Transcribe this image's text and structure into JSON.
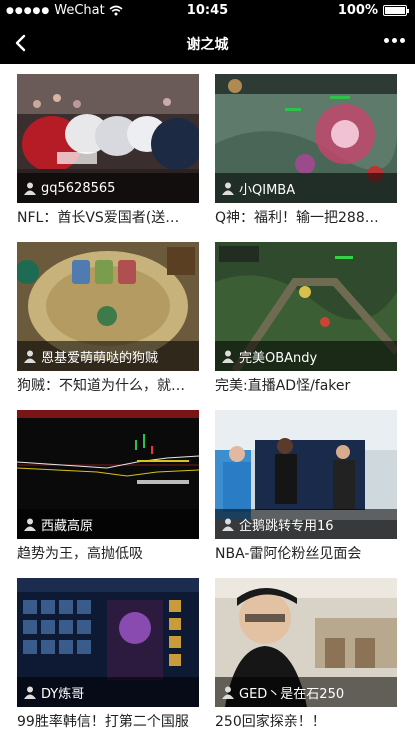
{
  "status_bar": {
    "signal_dots": "●●●●●",
    "carrier": "WeChat",
    "time": "10:45",
    "battery": "100%",
    "wifi_icon": "wifi-icon",
    "battery_level": 1.0
  },
  "nav": {
    "title": "谢之城",
    "back_icon": "chevron-left-icon",
    "more_icon": "more-dots-icon"
  },
  "cards": [
    {
      "user": "gq5628565",
      "caption": "NFL：酋长VS爱国者(送…"
    },
    {
      "user": "小QIMBA",
      "caption": "Q神：福利！输一把288…"
    },
    {
      "user": "恩基爱萌萌哒的狗贼",
      "caption": "狗贼：不知道为什么，就…"
    },
    {
      "user": "完美OBAndy",
      "caption": "完美:直播AD怪/faker"
    },
    {
      "user": "西藏高原",
      "caption": "趋势为王，高抛低吸"
    },
    {
      "user": "企鹅跳转专用16",
      "caption": "NBA-雷阿伦粉丝见面会"
    },
    {
      "user": "DY炼哥",
      "caption": "99胜率韩信！打第二个国服"
    },
    {
      "user": "GED丶是在石250",
      "caption": "250回家探亲！！"
    }
  ]
}
